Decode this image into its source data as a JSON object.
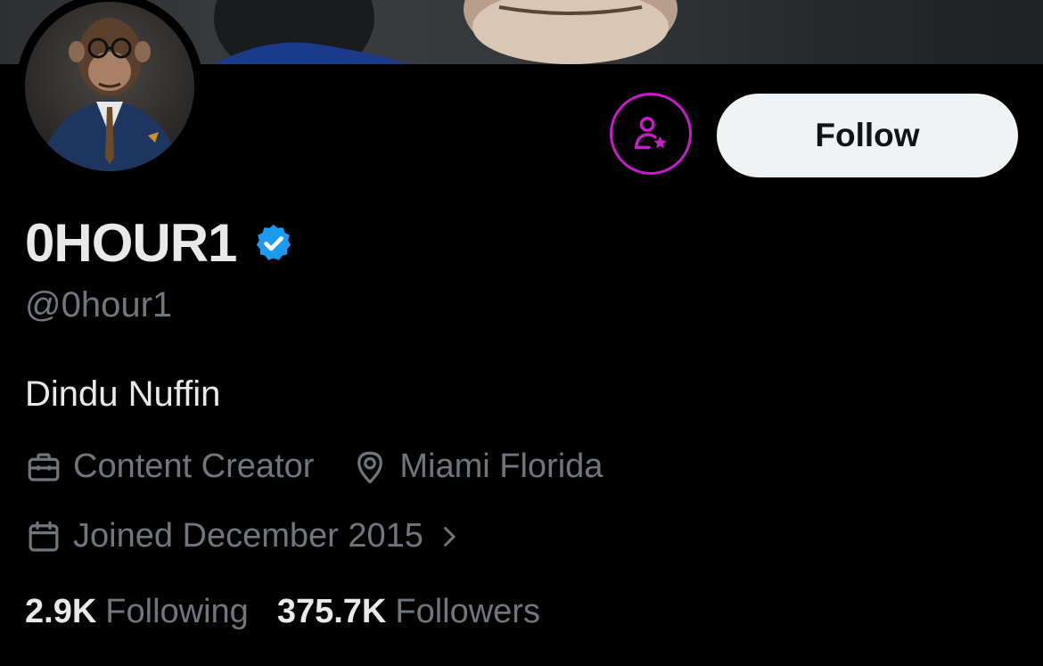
{
  "profile": {
    "display_name": "0HOUR1",
    "handle": "@0hour1",
    "bio": "Dindu Nuffin",
    "profession": "Content Creator",
    "location": "Miami Florida",
    "joined": "Joined December 2015"
  },
  "actions": {
    "follow_label": "Follow"
  },
  "stats": {
    "following_count": "2.9K",
    "following_label": "Following",
    "followers_count": "375.7K",
    "followers_label": "Followers"
  },
  "colors": {
    "background": "#000000",
    "primary_text": "#e7e9ea",
    "secondary_text": "#71767b",
    "verified": "#1d9bf0",
    "subscribe_accent": "#c91bc9",
    "follow_button_bg": "#eff3f4"
  },
  "icons": {
    "verified": "verified-badge-icon",
    "subscribe": "subscribe-person-star-icon",
    "profession": "briefcase-icon",
    "location": "location-pin-icon",
    "joined": "calendar-icon",
    "joined_more": "chevron-right-icon"
  }
}
